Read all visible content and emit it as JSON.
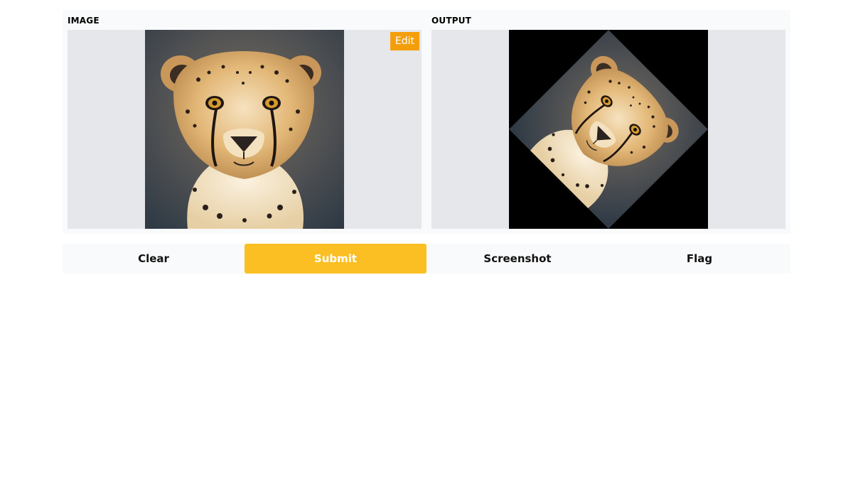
{
  "input_panel": {
    "label": "IMAGE",
    "edit_label": "Edit",
    "image_name": "cheetah-photo"
  },
  "output_panel": {
    "label": "OUTPUT",
    "image_name": "cheetah-photo-rotated",
    "rotation_degrees": 45
  },
  "actions": {
    "clear_label": "Clear",
    "submit_label": "Submit",
    "screenshot_label": "Screenshot",
    "flag_label": "Flag"
  },
  "colors": {
    "accent": "#fbbf24",
    "edit": "#f59e0b",
    "panel_bg": "#f9fafb",
    "image_bg": "#e5e7eb"
  }
}
